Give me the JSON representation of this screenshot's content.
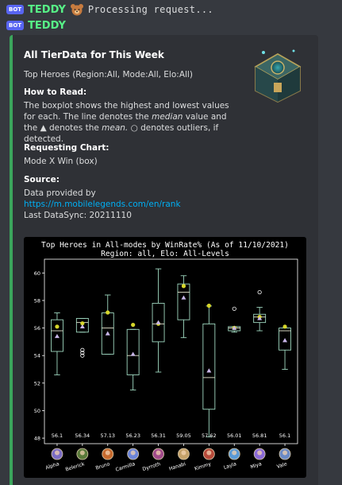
{
  "messages": [
    {
      "tag": "BOT",
      "username": "TEDDY",
      "text": "Processing request..."
    },
    {
      "tag": "BOT",
      "username": "TEDDY"
    }
  ],
  "embed": {
    "accent_color": "#3ba55c",
    "title": "All TierData for This Week",
    "description": "Top Heroes (Region:All, Mode:All, Elo:All)",
    "fields": [
      {
        "name": "How to Read:",
        "value_parts": [
          "The boxplot shows the highest and lowest values for each. The line denotes the ",
          "median",
          " value and the ▲ denotes the ",
          "mean.",
          " ○ denotes outliers, if detected."
        ]
      },
      {
        "name": "Requesting Chart:",
        "value": "Mode X Win (box)"
      },
      {
        "name": "Source:",
        "line1": "Data provided by",
        "link": "https://m.mobilelegends.com/en/rank",
        "line3": "Last DataSync: 20211110"
      }
    ]
  },
  "chart_data": {
    "type": "box",
    "title_line1": "Top Heroes in All-modes by WinRate% (As of 11/10/2021)",
    "title_line2": "Region: all, Elo: All-Levels",
    "ylim": [
      47.6,
      61
    ],
    "yticks": [
      48,
      50,
      52,
      54,
      56,
      58,
      60
    ],
    "grid": false,
    "categories": [
      "Alpha",
      "Belerick",
      "Bruno",
      "Carmilla",
      "Dyrroth",
      "Hanabi",
      "Kimmy",
      "Layla",
      "Miya",
      "Vale"
    ],
    "value_labels": [
      "56.1",
      "56.34",
      "57.13",
      "56.23",
      "56.31",
      "59.05",
      "57.62",
      "56.01",
      "56.81",
      "56.1"
    ],
    "boxes": [
      {
        "min": 52.6,
        "q1": 54.3,
        "median": 55.8,
        "q3": 56.6,
        "max": 57.1,
        "mean": 55.4,
        "outliers": [],
        "dot": 56.1
      },
      {
        "min": 55.7,
        "q1": 55.7,
        "median": 56.4,
        "q3": 56.7,
        "max": 56.7,
        "mean": 56.1,
        "outliers": [
          54.0,
          54.2,
          54.4
        ],
        "dot": 56.34
      },
      {
        "min": 54.1,
        "q1": 54.1,
        "median": 56.0,
        "q3": 57.1,
        "max": 58.4,
        "mean": 55.6,
        "outliers": [],
        "dot": 57.13
      },
      {
        "min": 51.5,
        "q1": 52.6,
        "median": 54.0,
        "q3": 55.9,
        "max": 55.9,
        "mean": 54.1,
        "outliers": [],
        "dot": 56.23
      },
      {
        "min": 52.8,
        "q1": 55.0,
        "median": 56.3,
        "q3": 57.8,
        "max": 60.3,
        "mean": 56.4,
        "outliers": [],
        "dot": 56.31
      },
      {
        "min": 55.3,
        "q1": 56.6,
        "median": 58.6,
        "q3": 59.2,
        "max": 59.8,
        "mean": 58.2,
        "outliers": [],
        "dot": 59.05
      },
      {
        "min": 48.1,
        "q1": 50.1,
        "median": 52.4,
        "q3": 56.3,
        "max": 57.6,
        "mean": 52.9,
        "outliers": [],
        "dot": 57.62
      },
      {
        "min": 55.7,
        "q1": 55.8,
        "median": 56.0,
        "q3": 56.1,
        "max": 56.1,
        "mean": 56.0,
        "outliers": [
          57.4
        ],
        "dot": 56.01
      },
      {
        "min": 55.8,
        "q1": 56.4,
        "median": 56.8,
        "q3": 57.0,
        "max": 57.5,
        "mean": 56.7,
        "outliers": [
          58.6
        ],
        "dot": 56.81
      },
      {
        "min": 53.0,
        "q1": 54.4,
        "median": 55.8,
        "q3": 56.0,
        "max": 56.0,
        "mean": 55.1,
        "outliers": [],
        "dot": 56.1
      }
    ],
    "colors": {
      "background": "#000000",
      "frame": "#ffffff",
      "box": "#9fd8c0",
      "median": "#e7e7d0",
      "mean_marker": "#c8b6e8",
      "highlight_dot": "#d6d62a",
      "text": "#ffffff"
    },
    "hero_icon_colors": [
      "#7b6cc2",
      "#5a7a3a",
      "#c66a2e",
      "#6d86d8",
      "#a04a8a",
      "#c5a26a",
      "#b64a3a",
      "#5a9ad6",
      "#8a6ad6",
      "#6a8ac6"
    ]
  }
}
